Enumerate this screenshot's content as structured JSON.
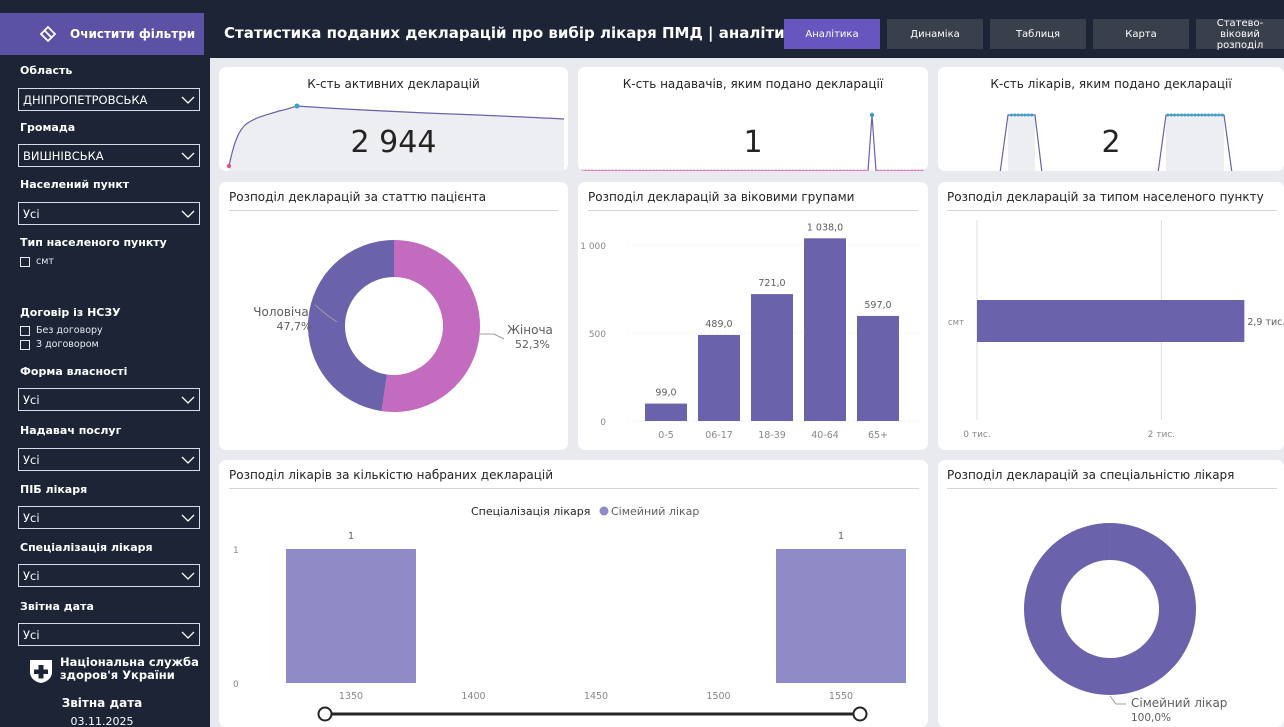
{
  "sidebar": {
    "clear_filters": "Очистити фільтри",
    "filters": [
      {
        "label": "Область",
        "value": "ДНІПРОПЕТРОВСЬКА"
      },
      {
        "label": "Громада",
        "value": "ВИШНІВСЬКА"
      },
      {
        "label": "Населений пункт",
        "value": "Усі"
      }
    ],
    "settlement_type": {
      "label": "Тип населеного пункту",
      "options": [
        "смт"
      ]
    },
    "contract": {
      "label": "Договір із НСЗУ",
      "options": [
        "Без договору",
        "З договором"
      ]
    },
    "filters2": [
      {
        "label": "Форма власності",
        "value": "Усі"
      },
      {
        "label": "Надавач послуг",
        "value": "Усі"
      },
      {
        "label": "ПІБ лікаря",
        "value": "Усі"
      },
      {
        "label": "Спеціалізація лікаря",
        "value": "Усі"
      },
      {
        "label": "Звітна дата",
        "value": "Усі"
      }
    ],
    "org_name": "Національна служба здоров'я України",
    "report_date_label": "Звітна дата",
    "report_date_value": "03.11.2025"
  },
  "header": {
    "title": "Статистика поданих декларацій про вибір лікаря ПМД | аналітика",
    "nav": [
      {
        "label": "Аналітика",
        "active": true
      },
      {
        "label": "Динаміка",
        "active": false
      },
      {
        "label": "Таблиця",
        "active": false
      },
      {
        "label": "Карта",
        "active": false
      },
      {
        "label": "Статево-віковий розподіл",
        "active": false
      }
    ]
  },
  "kpis": [
    {
      "title": "К-сть активних декларацій",
      "value": "2 944"
    },
    {
      "title": "К-сть надавачів, яким подано декларації",
      "value": "1"
    },
    {
      "title": "К-сть лікарів, яким подано декларації",
      "value": "2"
    }
  ],
  "colors": {
    "primary": "#6a62aa",
    "pink": "#c36bbf",
    "light": "#8f8bc6",
    "accent": "#6856c0",
    "sidebar": "#1c2436"
  },
  "charts": {
    "gender": {
      "title": "Розподіл декларацій за статтю пацієнта"
    },
    "age": {
      "title": "Розподіл декларацій за віковими групами"
    },
    "settlement": {
      "title": "Розподіл декларацій за типом населеного пункту"
    },
    "doctors": {
      "title": "Розподіл лікарів за кількістю набраних декларацій"
    },
    "specialty": {
      "title": "Розподіл декларацій за спеціальністю лікаря"
    }
  },
  "chart_data": [
    {
      "type": "pie",
      "categories": [
        "Чоловіча",
        "Жіноча"
      ],
      "values": [
        47.7,
        52.3
      ],
      "labels": [
        "47,7%",
        "52,3%"
      ]
    },
    {
      "type": "bar",
      "categories": [
        "0-5",
        "06-17",
        "18-39",
        "40-64",
        "65+"
      ],
      "values": [
        99.0,
        489.0,
        721.0,
        1038.0,
        597.0
      ],
      "value_labels": [
        "99,0",
        "489,0",
        "721,0",
        "1 038,0",
        "597,0"
      ],
      "y_ticks": [
        "0",
        "500",
        "1 000"
      ],
      "ylim": [
        0,
        1200
      ]
    },
    {
      "type": "bar",
      "orientation": "horizontal",
      "categories": [
        "смт"
      ],
      "values": [
        2.9
      ],
      "value_labels": [
        "2,9 тис."
      ],
      "x_ticks": [
        "0 тис.",
        "2 тис."
      ]
    },
    {
      "type": "bar",
      "legend_title": "Спеціалізація лікаря",
      "series": [
        {
          "name": "Сімейний лікар"
        }
      ],
      "x": [
        1350,
        1550
      ],
      "values": [
        1,
        1
      ],
      "value_labels": [
        "1",
        "1"
      ],
      "x_ticks": [
        "1350",
        "1400",
        "1450",
        "1500",
        "1550"
      ],
      "y_ticks": [
        "0",
        "1"
      ]
    },
    {
      "type": "pie",
      "categories": [
        "Сімейний лікар"
      ],
      "values": [
        100.0
      ],
      "labels": [
        "100,0%"
      ]
    }
  ]
}
